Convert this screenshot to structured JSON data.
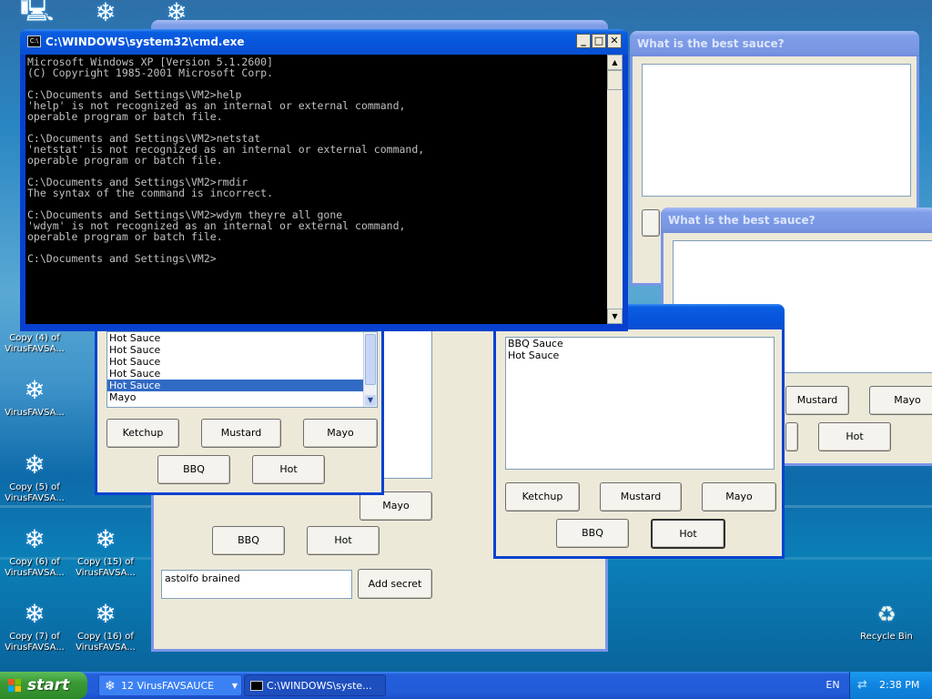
{
  "desktop": {
    "icons": [
      {
        "label": "Copy (4) of VirusFAVSA...",
        "icon": "snowflake-icon"
      },
      {
        "label": "VirusFAVSA...",
        "icon": "snowflake-icon"
      },
      {
        "label": "Copy (5) of VirusFAVSA...",
        "icon": "snowflake-icon"
      },
      {
        "label": "Copy (6) of VirusFAVSA...",
        "icon": "snowflake-icon"
      },
      {
        "label": "Copy (7) of VirusFAVSA...",
        "icon": "snowflake-icon"
      },
      {
        "label": "Copy (15) of VirusFAVSA...",
        "icon": "snowflake-icon"
      },
      {
        "label": "Copy (16) of VirusFAVSA...",
        "icon": "snowflake-icon"
      },
      {
        "label": "Recycle Bin",
        "icon": "recycle-bin-icon"
      }
    ],
    "partial_labels": [
      "Virus",
      "Cop Viru",
      "Cop Viru",
      "Copy VirusFAVSA..."
    ]
  },
  "cmd": {
    "title": "C:\\WINDOWS\\system32\\cmd.exe",
    "lines": [
      "Microsoft Windows XP [Version 5.1.2600]",
      "(C) Copyright 1985-2001 Microsoft Corp.",
      "",
      "C:\\Documents and Settings\\VM2>help",
      "'help' is not recognized as an internal or external command,",
      "operable program or batch file.",
      "",
      "C:\\Documents and Settings\\VM2>netstat",
      "'netstat' is not recognized as an internal or external command,",
      "operable program or batch file.",
      "",
      "C:\\Documents and Settings\\VM2>rmdir",
      "The syntax of the command is incorrect.",
      "",
      "C:\\Documents and Settings\\VM2>wdym theyre all gone",
      "'wdym' is not recognized as an internal or external command,",
      "operable program or batch file.",
      "",
      "C:\\Documents and Settings\\VM2>"
    ]
  },
  "sauce": {
    "title": "What is the best sauce?",
    "buttons": {
      "ketchup": "Ketchup",
      "mustard": "Mustard",
      "mayo": "Mayo",
      "bbq": "BBQ",
      "hot": "Hot"
    },
    "left_list": [
      "Hot Sauce",
      "Hot Sauce",
      "Hot Sauce",
      "Hot Sauce",
      "Hot Sauce",
      "Mayo"
    ],
    "right_list": [
      "BBQ Sauce",
      "Hot Sauce"
    ],
    "secret_input": "astolfo brained",
    "add_secret": "Add secret"
  },
  "taskbar": {
    "start": "start",
    "tasks": [
      "12 VirusFAVSAUCE",
      "C:\\WINDOWS\\syste..."
    ],
    "language": "EN",
    "clock": "2:38 PM"
  },
  "colors": {
    "title_active": "#0654dc",
    "title_inactive": "#7896e2",
    "window_face": "#ece9d8",
    "list_selection": "#316ac5"
  }
}
